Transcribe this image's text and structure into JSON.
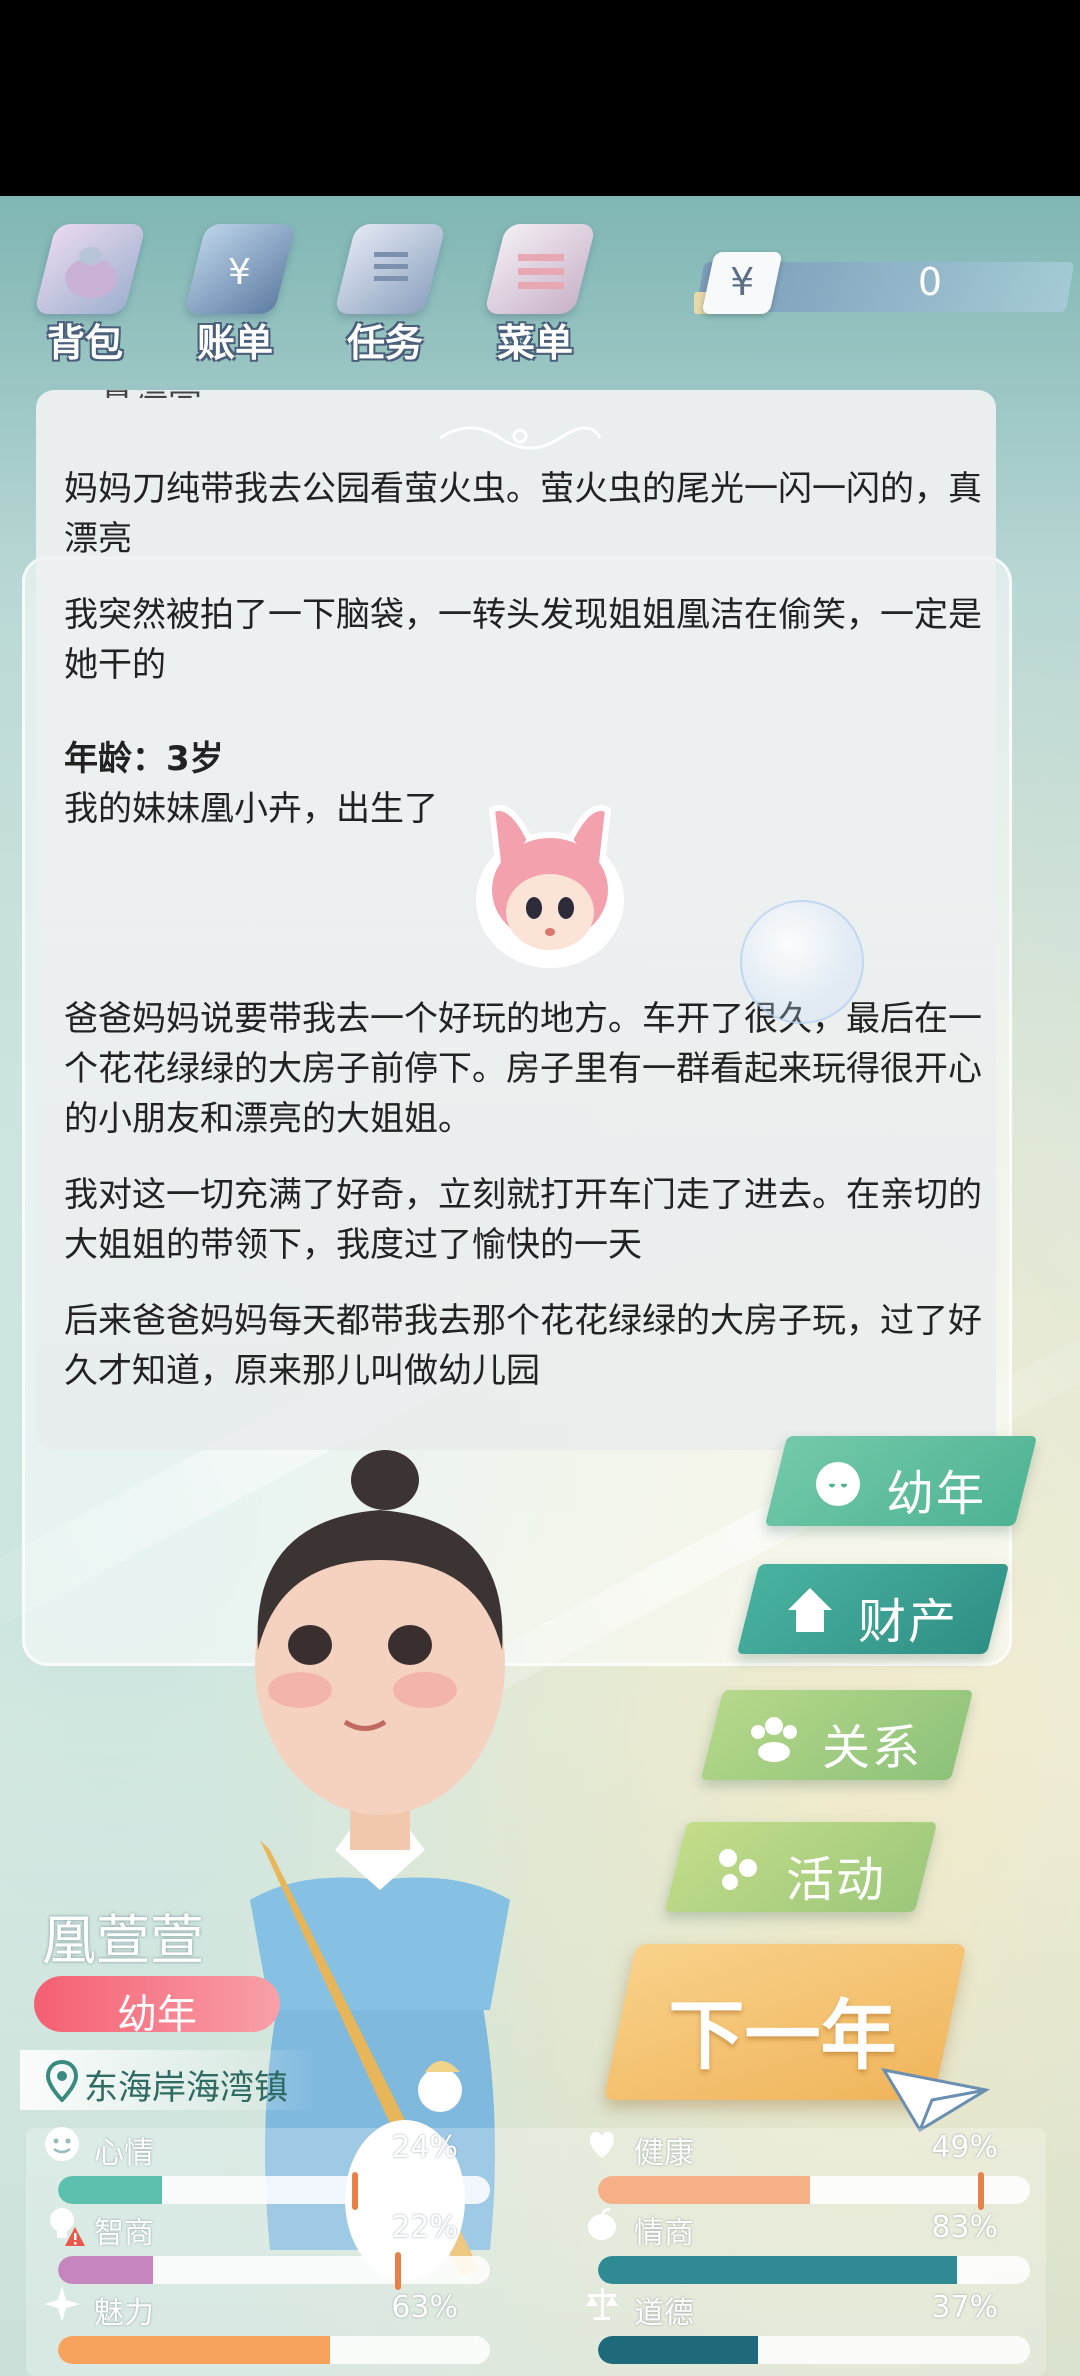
{
  "toolbar": {
    "items": [
      {
        "label": "背包",
        "icon": "backpack-icon"
      },
      {
        "label": "账单",
        "icon": "bill-icon"
      },
      {
        "label": "任务",
        "icon": "task-icon"
      },
      {
        "label": "菜单",
        "icon": "menu-icon"
      }
    ],
    "currency_symbol": "¥",
    "money": "0"
  },
  "story": {
    "cut_line": "真漂亮",
    "paragraphs": [
      "妈妈刀纯带我去公园看萤火虫。萤火虫的尾光一闪一闪的，真漂亮",
      "我突然被拍了一下脑袋，一转头发现姐姐凰洁在偷笑，一定是她干的"
    ],
    "age_heading": "年龄：3岁",
    "birth_line": "我的妹妹凰小卉，出生了",
    "paragraphs2": [
      "爸爸妈妈说要带我去一个好玩的地方。车开了很久，最后在一个花花绿绿的大房子前停下。房子里有一群看起来玩得很开心的小朋友和漂亮的大姐姐。",
      "我对这一切充满了好奇，立刻就打开车门走了进去。在亲切的大姐姐的带领下，我度过了愉快的一天",
      "后来爸爸妈妈每天都带我去那个花花绿绿的大房子玩，过了好久才知道，原来那儿叫做幼儿园"
    ]
  },
  "menu": {
    "items": [
      {
        "label": "幼年",
        "icon": "baby-face-icon",
        "color": "#6cc4a6"
      },
      {
        "label": "财产",
        "icon": "house-icon",
        "color": "#3fa494"
      },
      {
        "label": "关系",
        "icon": "people-icon",
        "color": "#a9cf7a"
      },
      {
        "label": "活动",
        "icon": "dots-icon",
        "color": "#b9d67e"
      }
    ],
    "next_year": "下一年"
  },
  "character": {
    "name": "凰萱萱",
    "stage": "幼年",
    "location": "东海岸海湾镇"
  },
  "stats": [
    {
      "label": "心情",
      "value": "24%",
      "fraction": 0.24,
      "color": "#5dbfae",
      "icon": "smiley-icon",
      "warning": false,
      "marker": 0.68
    },
    {
      "label": "健康",
      "value": "49%",
      "fraction": 0.49,
      "color": "#f5b088",
      "icon": "heart-icon",
      "warning": false,
      "marker": 0.88
    },
    {
      "label": "智商",
      "value": "22%",
      "fraction": 0.22,
      "color": "#c586c0",
      "icon": "bulb-icon",
      "warning": true,
      "marker": 0.78
    },
    {
      "label": "情商",
      "value": "83%",
      "fraction": 0.83,
      "color": "#2f8a94",
      "icon": "apple-icon",
      "warning": false,
      "marker": null
    },
    {
      "label": "魅力",
      "value": "63%",
      "fraction": 0.63,
      "color": "#f7a35d",
      "icon": "sparkle-icon",
      "warning": false,
      "marker": null
    },
    {
      "label": "道德",
      "value": "37%",
      "fraction": 0.37,
      "color": "#1f6a7a",
      "icon": "scale-icon",
      "warning": false,
      "marker": null
    }
  ]
}
